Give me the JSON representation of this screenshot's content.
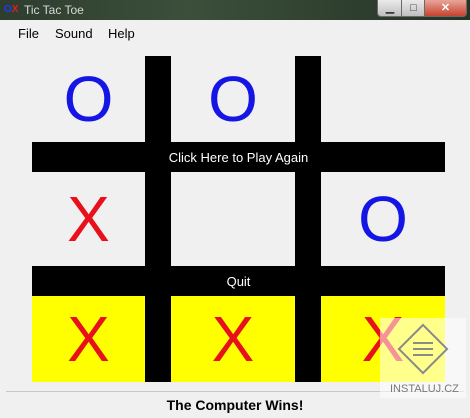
{
  "window": {
    "title": "Tic Tac Toe",
    "icon_o": "O",
    "icon_x": "X",
    "min_glyph": "▁",
    "max_glyph": "□",
    "close_glyph": "✕"
  },
  "menu": {
    "items": [
      "File",
      "Sound",
      "Help"
    ]
  },
  "board": {
    "cells": [
      "O",
      "O",
      "",
      "X",
      "",
      "O",
      "X",
      "X",
      "X"
    ],
    "winning_cells": [
      6,
      7,
      8
    ],
    "x_color": "#e8101a",
    "o_color": "#1515e6",
    "win_highlight": "#ffff00"
  },
  "buttons": {
    "play_again": "Click Here to Play Again",
    "quit": "Quit"
  },
  "status": {
    "message": "The Computer Wins!"
  },
  "watermark": {
    "text": "INSTALUJ.CZ",
    "icon": "stamp-icon"
  }
}
